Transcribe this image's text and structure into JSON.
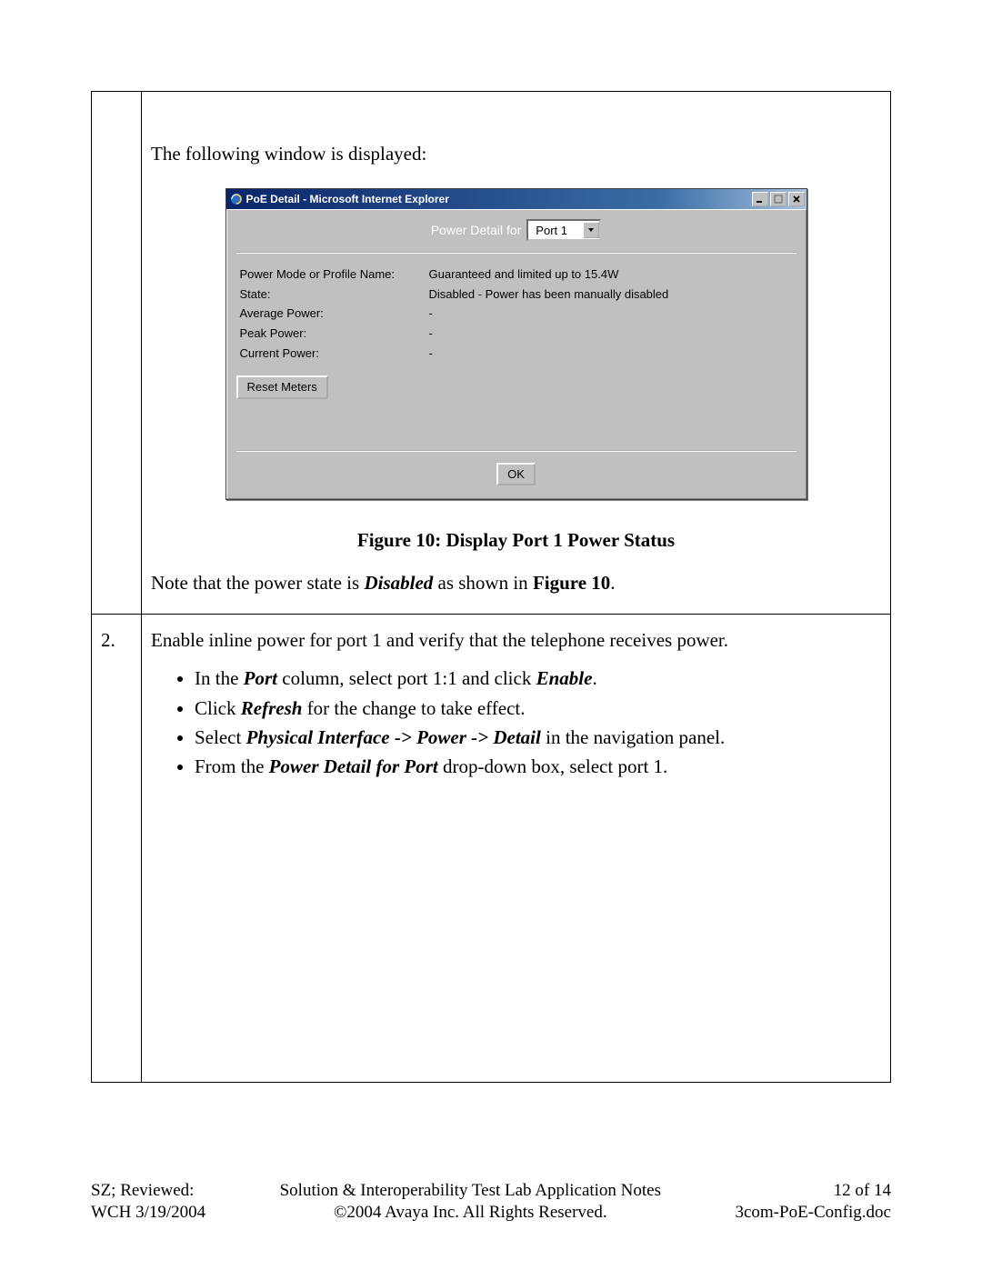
{
  "row1": {
    "intro": "The following window is displayed:",
    "window": {
      "title": "PoE Detail - Microsoft Internet Explorer",
      "header_label": "Power Detail for",
      "port_selected": "Port 1",
      "fields": {
        "power_mode_label": "Power Mode or Profile Name:",
        "power_mode_value": "Guaranteed and limited up to 15.4W",
        "state_label": "State:",
        "state_value": "Disabled - Power has been manually disabled",
        "avg_label": "Average Power:",
        "avg_value": "-",
        "peak_label": "Peak Power:",
        "peak_value": "-",
        "current_label": "Current Power:",
        "current_value": "-"
      },
      "reset_btn": "Reset Meters",
      "ok_btn": "OK"
    },
    "figure_caption": "Figure 10: Display Port 1 Power Status",
    "note_prefix": "Note that the power state is ",
    "note_disabled": "Disabled",
    "note_mid": " as shown in ",
    "note_figure": "Figure 10",
    "note_suffix": "."
  },
  "row2": {
    "num": "2.",
    "intro": "Enable inline power for port 1 and verify that the telephone receives power.",
    "b1_a": "In the ",
    "b1_port": "Port",
    "b1_b": " column, select port 1:1 and click ",
    "b1_enable": "Enable",
    "b1_c": ".",
    "b2_a": "Click ",
    "b2_refresh": "Refresh",
    "b2_b": " for the change to take effect.",
    "b3_a": "Select ",
    "b3_path": "Physical Interface -> Power -> Detail",
    "b3_b": " in the navigation panel.",
    "b4_a": "From the ",
    "b4_label": "Power Detail for Port",
    "b4_b": " drop-down box, select port 1."
  },
  "footer": {
    "left1": "SZ; Reviewed:",
    "left2": "WCH 3/19/2004",
    "center1": "Solution & Interoperability Test Lab Application Notes",
    "center2": "©2004 Avaya Inc. All Rights Reserved.",
    "right1": "12 of 14",
    "right2": "3com-PoE-Config.doc"
  }
}
